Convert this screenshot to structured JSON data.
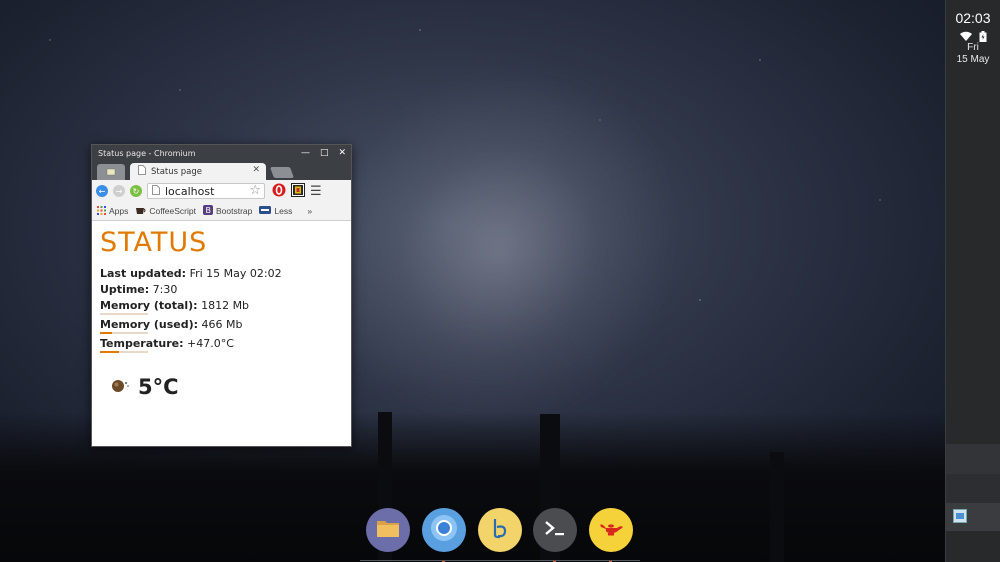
{
  "system": {
    "clock": "02:03",
    "day": "Fri",
    "date": "15 May"
  },
  "window": {
    "title": "Status page - Chromium",
    "tab_label": "Status page",
    "address": "localhost",
    "bookmarks": [
      "Apps",
      "CoffeeScript",
      "Bootstrap",
      "Less"
    ],
    "more_bookmarks": "»"
  },
  "page": {
    "heading": "STATUS",
    "last_updated_label": "Last updated:",
    "last_updated_value": "Fri 15 May 02:02",
    "uptime_label": "Uptime:",
    "uptime_value": "7:30",
    "mem_total_label": "Memory (total):",
    "mem_total_value": "1812 Mb",
    "mem_used_label": "Memory (used):",
    "mem_used_value": "466 Mb",
    "mem_used_fraction": 0.257,
    "temp_label": "Temperature:",
    "temp_value": "+47.0°C",
    "temp_fraction": 0.4,
    "weather_temp": "5°C"
  },
  "dock": {
    "apps": [
      "files-icon",
      "chromium-icon",
      "bracket-icon",
      "terminal-icon",
      "genie-lamp-icon"
    ]
  },
  "colors": {
    "accent": "#e07a00",
    "shelf": "#27292b"
  }
}
